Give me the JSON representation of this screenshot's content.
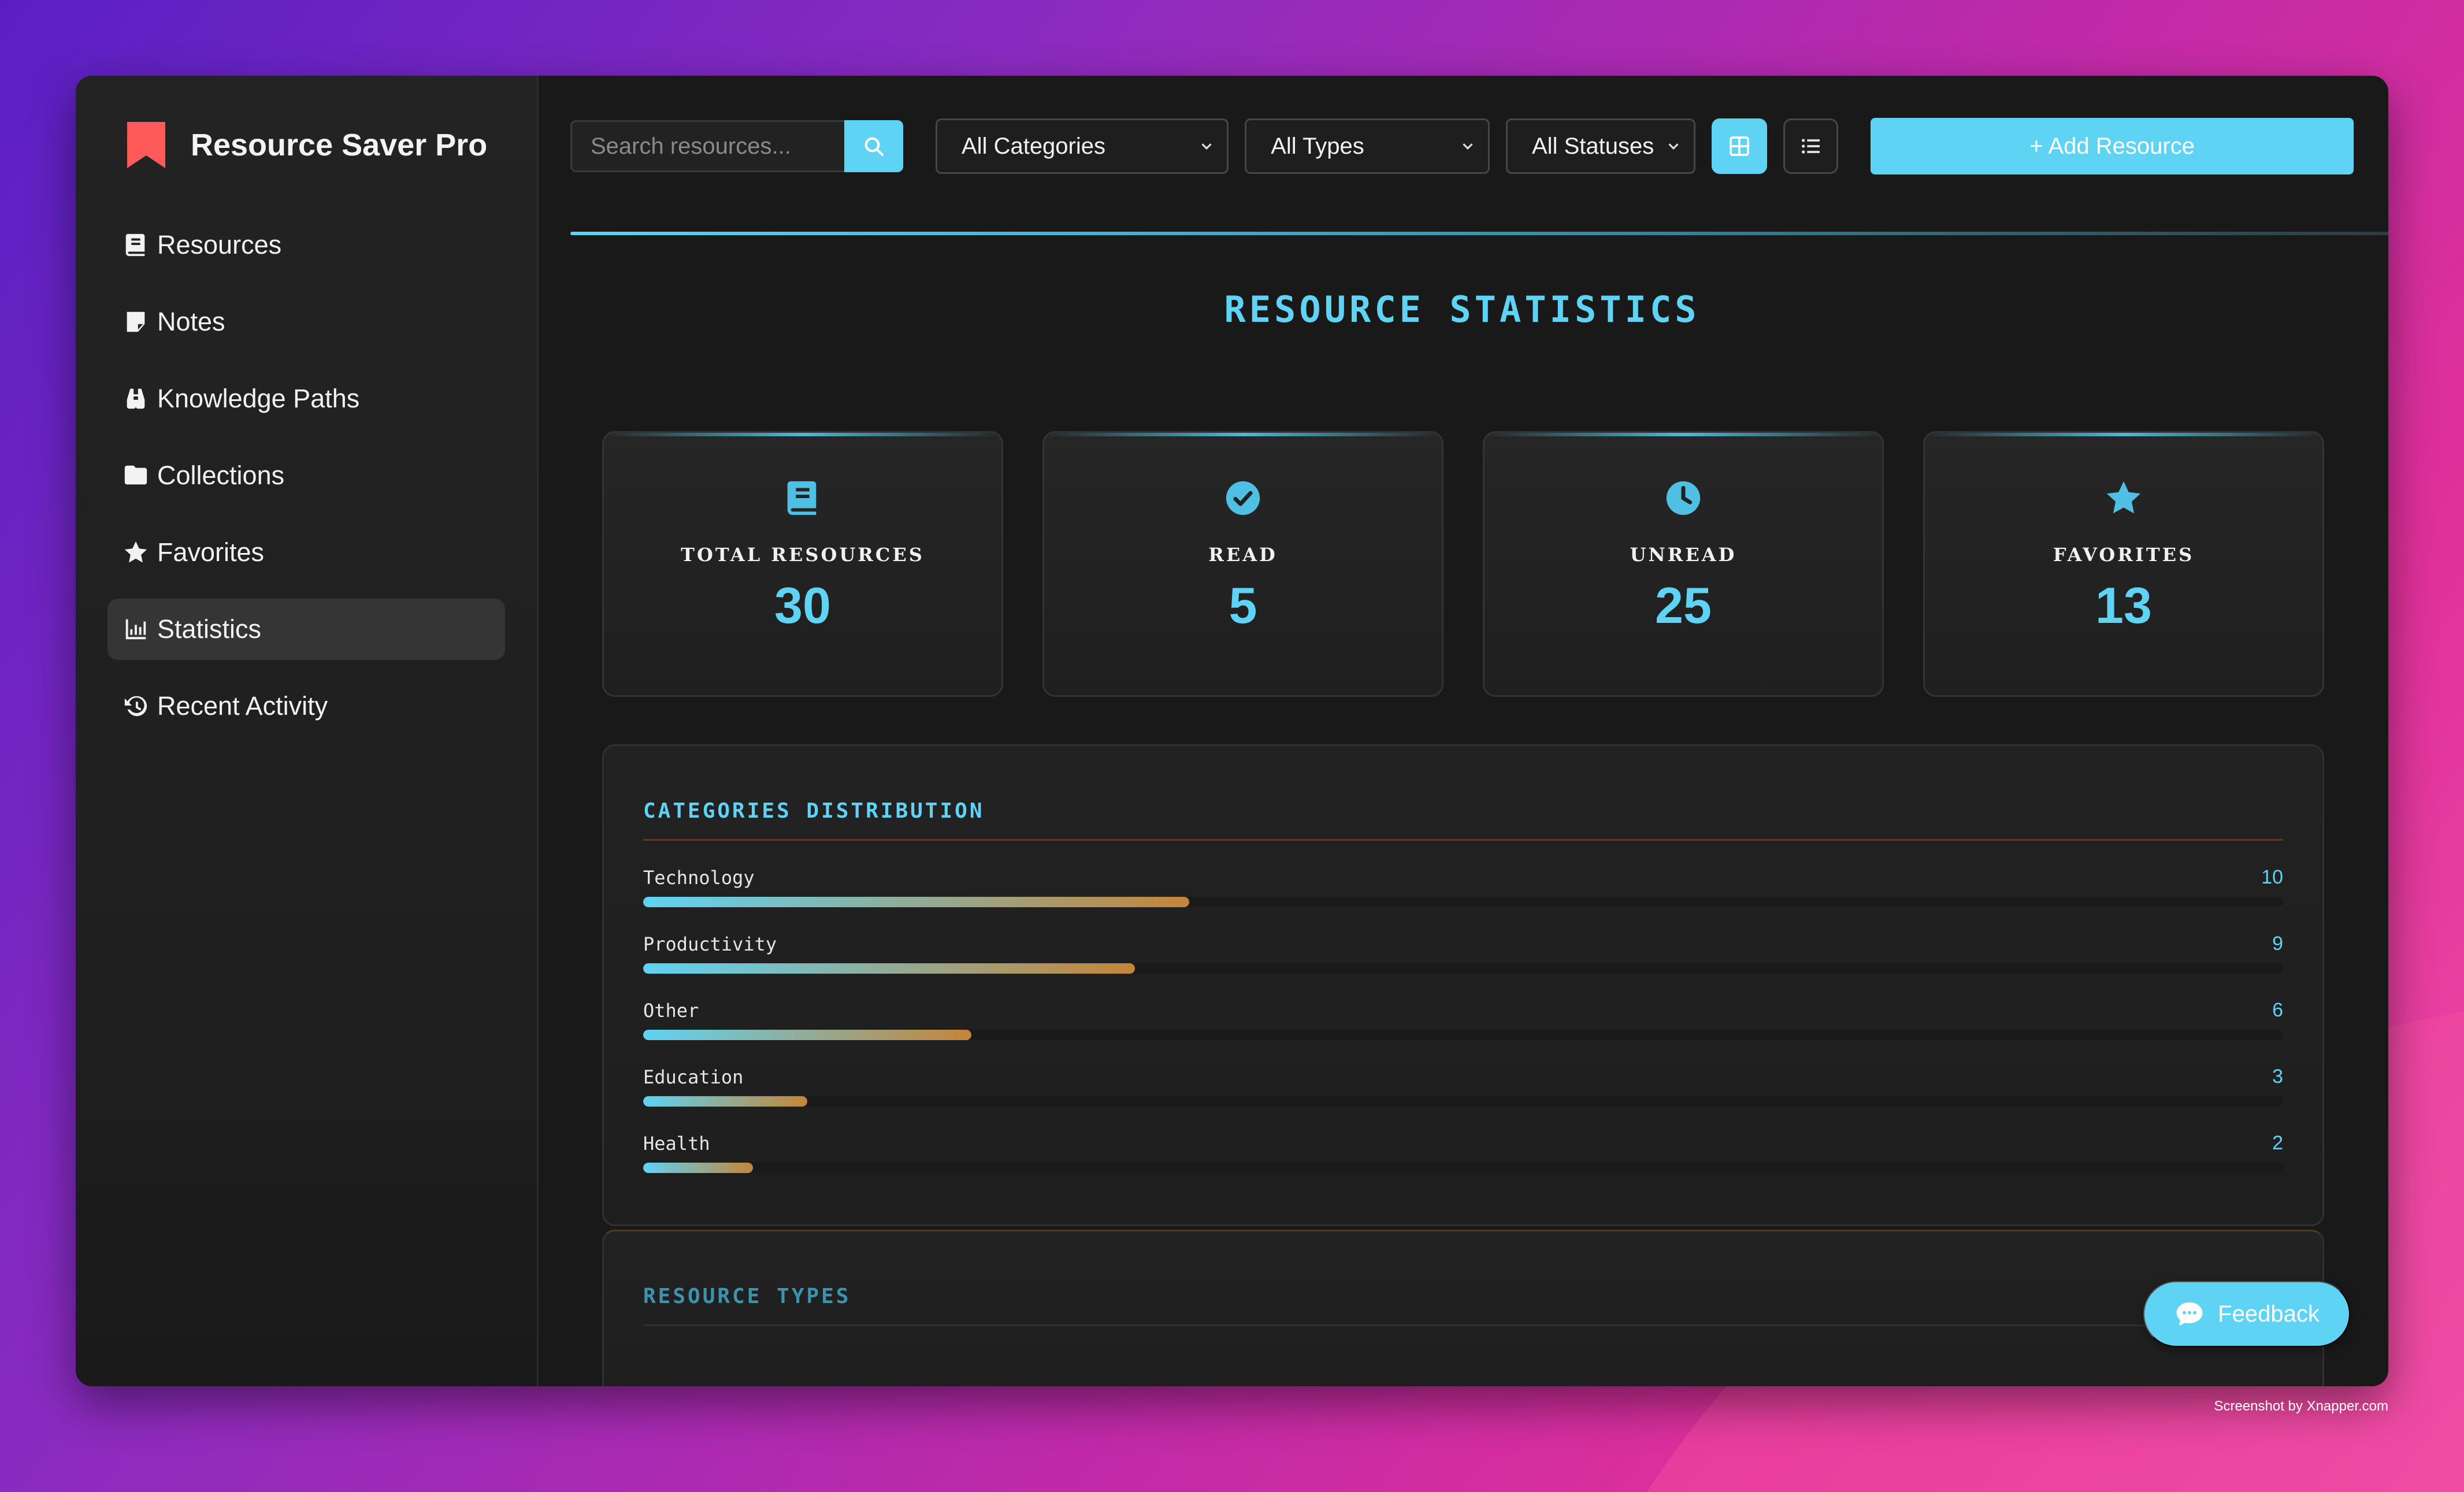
{
  "app": {
    "title": "Resource Saver Pro"
  },
  "sidebar": {
    "items": [
      {
        "label": "Resources",
        "icon": "book-icon"
      },
      {
        "label": "Notes",
        "icon": "note-icon"
      },
      {
        "label": "Knowledge Paths",
        "icon": "binoculars-icon"
      },
      {
        "label": "Collections",
        "icon": "folder-icon"
      },
      {
        "label": "Favorites",
        "icon": "star-icon"
      },
      {
        "label": "Statistics",
        "icon": "chart-icon",
        "active": true
      },
      {
        "label": "Recent Activity",
        "icon": "history-icon"
      }
    ]
  },
  "toolbar": {
    "search_placeholder": "Search resources...",
    "category_filter": "All Categories",
    "type_filter": "All Types",
    "status_filter": "All Statuses",
    "add_label": "+ Add Resource"
  },
  "page": {
    "heading": "RESOURCE STATISTICS"
  },
  "stats": [
    {
      "label": "TOTAL RESOURCES",
      "value": "30",
      "icon": "book-icon"
    },
    {
      "label": "READ",
      "value": "5",
      "icon": "check-circle-icon"
    },
    {
      "label": "UNREAD",
      "value": "25",
      "icon": "clock-icon"
    },
    {
      "label": "FAVORITES",
      "value": "13",
      "icon": "star-icon"
    }
  ],
  "categories": {
    "title": "CATEGORIES DISTRIBUTION",
    "items": [
      {
        "name": "Technology",
        "count": 10,
        "fraction": 0.333
      },
      {
        "name": "Productivity",
        "count": 9,
        "fraction": 0.3
      },
      {
        "name": "Other",
        "count": 6,
        "fraction": 0.2
      },
      {
        "name": "Education",
        "count": 3,
        "fraction": 0.1
      },
      {
        "name": "Health",
        "count": 2,
        "fraction": 0.067
      }
    ]
  },
  "types": {
    "title": "RESOURCE TYPES"
  },
  "feedback": {
    "label": "Feedback"
  },
  "watermark": "Screenshot by Xnapper.com",
  "colors": {
    "accent": "#5fd3f3",
    "bar_end": "#c4853a",
    "logo": "#ff5a5a"
  }
}
